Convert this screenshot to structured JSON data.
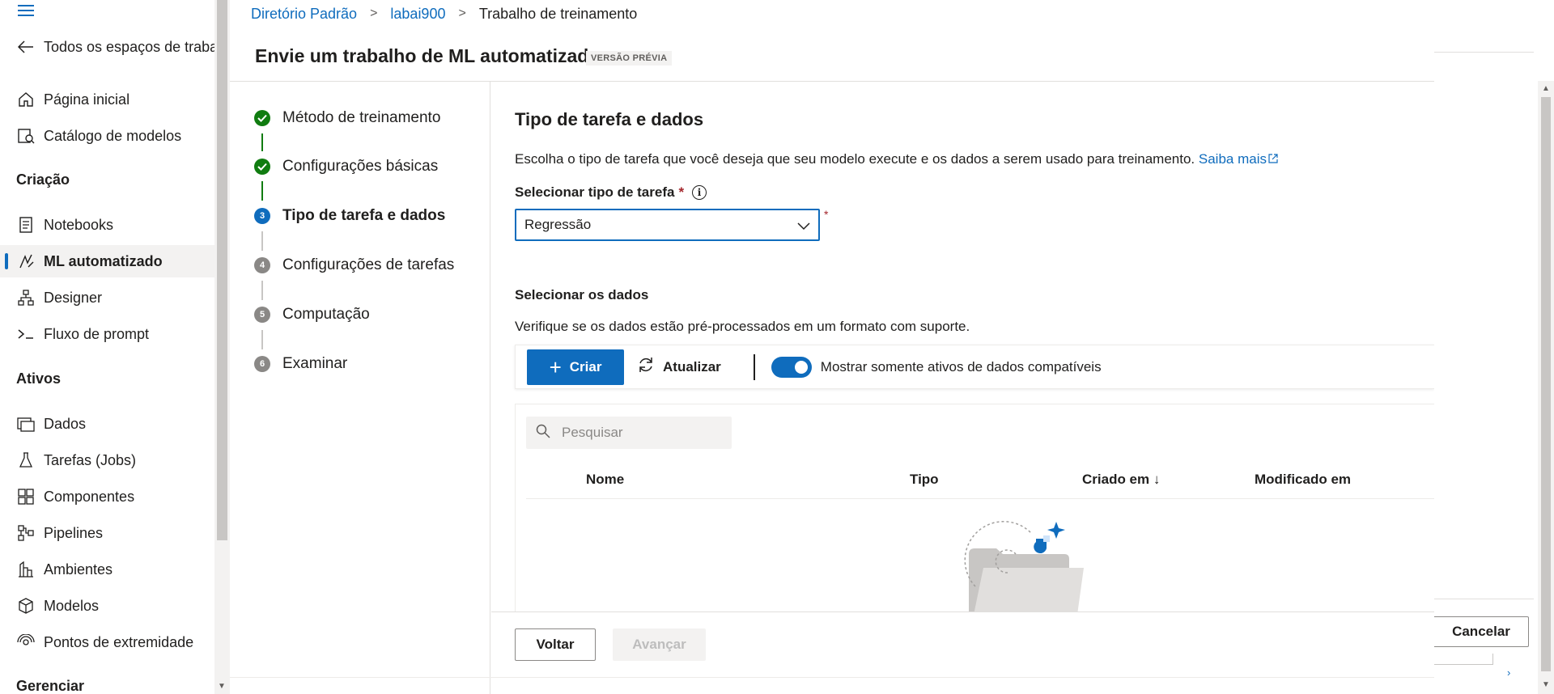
{
  "nav": {
    "back_label": "Todos os espaços de trabal",
    "items_top": [
      {
        "label": "Página inicial",
        "icon": "home-icon"
      },
      {
        "label": "Catálogo de modelos",
        "icon": "catalog-icon"
      }
    ],
    "section_creation": "Criação",
    "items_creation": [
      {
        "label": "Notebooks",
        "icon": "notebook-icon"
      },
      {
        "label": "ML automatizado",
        "icon": "automl-icon",
        "active": true
      },
      {
        "label": "Designer",
        "icon": "designer-icon"
      },
      {
        "label": "Fluxo de prompt",
        "icon": "prompt-flow-icon"
      }
    ],
    "section_assets": "Ativos",
    "items_assets": [
      {
        "label": "Dados",
        "icon": "data-icon"
      },
      {
        "label": "Tarefas (Jobs)",
        "icon": "jobs-icon"
      },
      {
        "label": "Componentes",
        "icon": "components-icon"
      },
      {
        "label": "Pipelines",
        "icon": "pipelines-icon"
      },
      {
        "label": "Ambientes",
        "icon": "environments-icon"
      },
      {
        "label": "Modelos",
        "icon": "models-icon"
      },
      {
        "label": "Pontos de extremidade",
        "icon": "endpoints-icon"
      }
    ],
    "section_manage": "Gerenciar"
  },
  "breadcrumb": {
    "items": [
      "Diretório Padrão",
      "labai900"
    ],
    "current": "Trabalho de treinamento"
  },
  "header": {
    "title": "Envie um trabalho de ML automatizado",
    "badge": "VERSÃO PRÉVIA"
  },
  "steps": [
    {
      "num": "1",
      "label": "Método de treinamento",
      "state": "done"
    },
    {
      "num": "2",
      "label": "Configurações básicas",
      "state": "done"
    },
    {
      "num": "3",
      "label": "Tipo de tarefa e dados",
      "state": "current"
    },
    {
      "num": "4",
      "label": "Configurações de tarefas",
      "state": "todo"
    },
    {
      "num": "5",
      "label": "Computação",
      "state": "todo"
    },
    {
      "num": "6",
      "label": "Examinar",
      "state": "todo"
    }
  ],
  "main": {
    "title": "Tipo de tarefa e dados",
    "description": "Escolha o tipo de tarefa que você deseja que seu modelo execute e os dados a serem usado para treinamento.",
    "learn_more": "Saiba mais",
    "task_type_label": "Selecionar tipo de tarefa",
    "required_mark": "*",
    "task_type_value": "Regressão",
    "data_title": "Selecionar os dados",
    "data_desc": "Verifique se os dados estão pré-processados em um formato com suporte.",
    "toolbar": {
      "create_label": "Criar",
      "refresh_label": "Atualizar",
      "toggle_label": "Mostrar somente ativos de dados compatíveis",
      "toggle_on": true
    },
    "search_placeholder": "Pesquisar",
    "columns": [
      "Nome",
      "Tipo",
      "Criado em",
      "Modificado em"
    ],
    "sort_arrow": "↓"
  },
  "footer": {
    "back_label": "Voltar",
    "next_label": "Avançar",
    "cancel_label": "Cancelar"
  },
  "colors": {
    "accent": "#0f6cbd",
    "done": "#107c10",
    "required": "#a4262c"
  }
}
